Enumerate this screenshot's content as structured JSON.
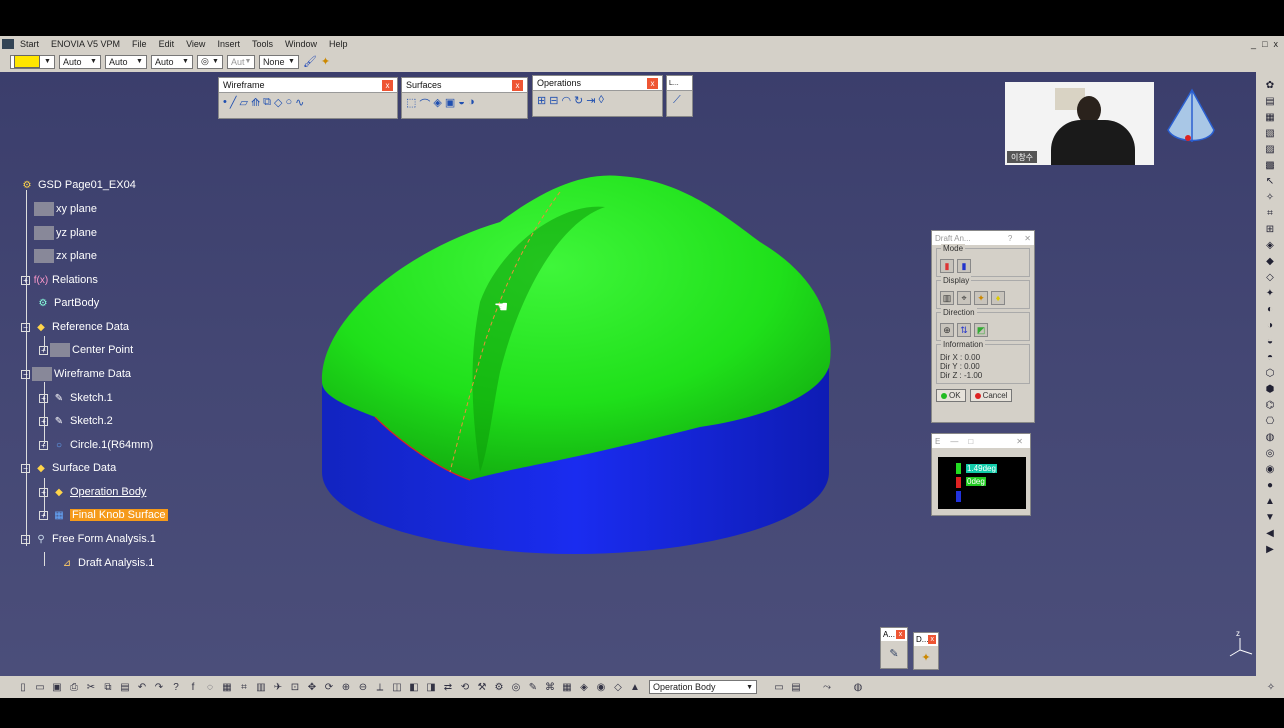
{
  "menubar": {
    "items": [
      "Start",
      "ENOVIA V5 VPM",
      "File",
      "Edit",
      "View",
      "Insert",
      "Tools",
      "Window",
      "Help"
    ],
    "window_controls": [
      "_",
      "□",
      "x"
    ]
  },
  "toolbar1": {
    "color_swatch": "#ffe600",
    "dropdowns": [
      "Auto",
      "Auto",
      "Auto",
      "◎",
      "Aut",
      "None"
    ]
  },
  "toolbars": {
    "wireframe": "Wireframe",
    "surfaces": "Surfaces",
    "operations": "Operations",
    "small": "L...",
    "mini_a": "A...",
    "mini_d": "D..."
  },
  "tree": {
    "root": "GSD Page01_EX04",
    "xy": "xy plane",
    "yz": "yz plane",
    "zx": "zx plane",
    "relations": "Relations",
    "partbody": "PartBody",
    "refdata": "Reference Data",
    "center": "Center Point",
    "wiredata": "Wireframe Data",
    "sketch1": "Sketch.1",
    "sketch2": "Sketch.2",
    "circle": "Circle.1(R64mm)",
    "surfdata": "Surface Data",
    "opbody": "Operation Body",
    "finalknob": "Final Knob Surface",
    "ffa": "Free Form Analysis.1",
    "draft": "Draft Analysis.1"
  },
  "draft_dialog": {
    "title": "Draft An...",
    "help": "?",
    "close": "✕",
    "mode": "Mode",
    "display": "Display",
    "direction": "Direction",
    "information": "Information",
    "dirx": "Dir X : 0.00",
    "diry": "Dir Y : 0.00",
    "dirz": "Dir Z : -1.00",
    "ok": "OK",
    "cancel": "Cancel"
  },
  "color_scale": {
    "title": "E",
    "high": "1.49deg",
    "low": "0deg"
  },
  "webcam": {
    "caption": "이창수"
  },
  "bottombar": {
    "combo": "Operation Body"
  },
  "colors": {
    "knob_green": "#1fe01a",
    "base_blue": "#1020d8",
    "viewport": "#444774",
    "highlight": "#f59a1a"
  }
}
